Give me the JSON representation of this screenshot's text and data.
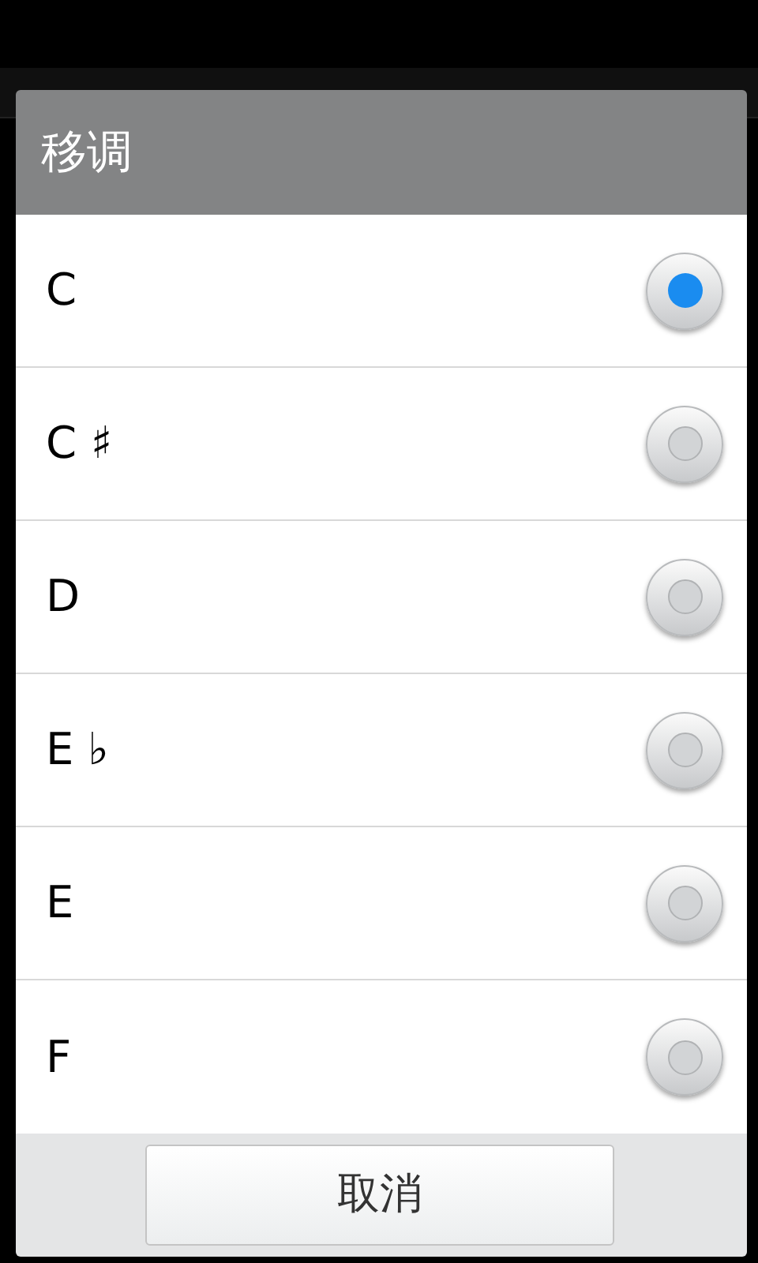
{
  "dialog": {
    "title": "移调",
    "options": [
      {
        "label": "C",
        "selected": true
      },
      {
        "label": "C ♯",
        "selected": false
      },
      {
        "label": "D",
        "selected": false
      },
      {
        "label": "E ♭",
        "selected": false
      },
      {
        "label": "E",
        "selected": false
      },
      {
        "label": "F",
        "selected": false
      }
    ],
    "buttons": [
      "取消"
    ]
  }
}
